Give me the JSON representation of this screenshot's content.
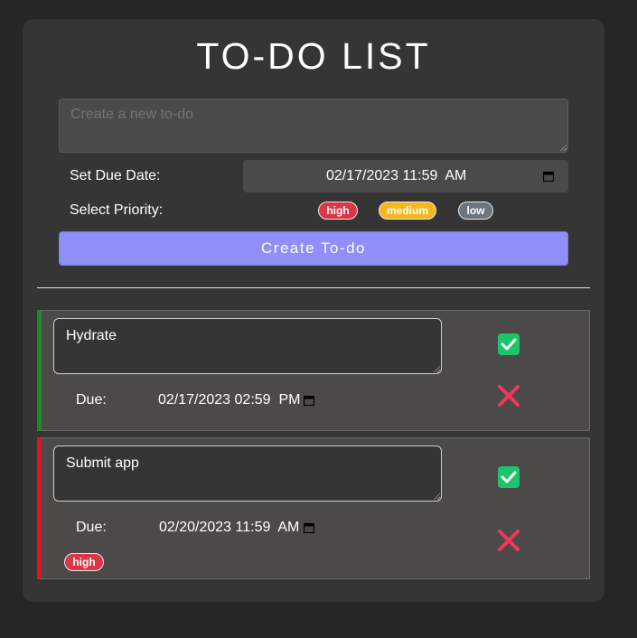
{
  "app": {
    "title": "TO-DO LIST"
  },
  "form": {
    "new_todo_placeholder": "Create a new to-do",
    "due_date_label": "Set Due Date:",
    "due_date_value": "02/17/2023 11:59  AM",
    "priority_label": "Select Priority:",
    "priorities": [
      {
        "label": "high",
        "color": "#dc3545"
      },
      {
        "label": "medium",
        "color": "#f5b81b"
      },
      {
        "label": "low",
        "color": "#6c757d"
      }
    ],
    "create_button": "Create To-do"
  },
  "todos": [
    {
      "text": "Hydrate",
      "due_label": "Due:",
      "due_value": "02/17/2023 02:59  PM",
      "border_color": "#1f8a1f",
      "priority": ""
    },
    {
      "text": "Submit app",
      "due_label": "Due:",
      "due_value": "02/20/2023 11:59  AM",
      "border_color": "#e0141e",
      "priority": "high"
    }
  ],
  "icons": {
    "complete": "check-icon",
    "delete": "x-icon",
    "calendar": "calendar-icon"
  },
  "colors": {
    "accent": "#8f8ffa",
    "check": "#1ec46a",
    "delete": "#f0385a"
  }
}
